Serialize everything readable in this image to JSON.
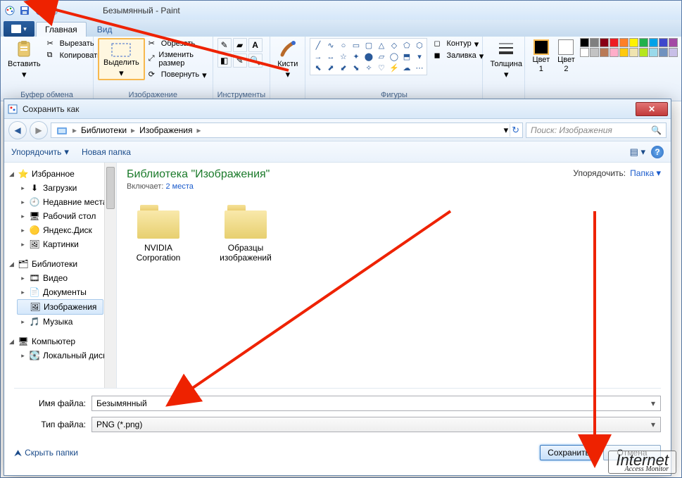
{
  "paint": {
    "title": "Безымянный - Paint",
    "tabs": {
      "home": "Главная",
      "view": "Вид"
    },
    "clipboard": {
      "paste": "Вставить",
      "cut": "Вырезать",
      "copy": "Копировать",
      "group": "Буфер обмена"
    },
    "image": {
      "select": "Выделить",
      "crop": "Обрезать",
      "resize": "Изменить размер",
      "rotate": "Повернуть",
      "group": "Изображение"
    },
    "tools": {
      "group": "Инструменты"
    },
    "brushes": {
      "label": "Кисти"
    },
    "shapes": {
      "outline": "Контур",
      "fill": "Заливка",
      "group": "Фигуры"
    },
    "size": {
      "label": "Толщина"
    },
    "colors": {
      "c1": "Цвет 1",
      "c2": "Цвет 2"
    }
  },
  "dialog": {
    "title": "Сохранить как",
    "breadcrumb": [
      "Библиотеки",
      "Изображения"
    ],
    "searchPlaceholder": "Поиск: Изображения",
    "refresh_hint": "↻",
    "toolbar": {
      "organize": "Упорядочить",
      "newfolder": "Новая папка"
    },
    "tree": {
      "favorites": "Избранное",
      "fav_items": [
        "Загрузки",
        "Недавние места",
        "Рабочий стол",
        "Яндекс.Диск",
        "Картинки"
      ],
      "libraries": "Библиотеки",
      "lib_items": [
        "Видео",
        "Документы",
        "Изображения",
        "Музыка"
      ],
      "computer": "Компьютер",
      "comp_items": [
        "Локальный диск"
      ]
    },
    "content": {
      "title": "Библиотека \"Изображения\"",
      "sub_prefix": "Включает:",
      "sub_link": "2 места",
      "sort_label": "Упорядочить:",
      "sort_value": "Папка",
      "folders": [
        "NVIDIA Corporation",
        "Образцы изображений"
      ]
    },
    "fields": {
      "name_label": "Имя файла:",
      "name_value": "Безымянный",
      "type_label": "Тип файла:",
      "type_value": "PNG (*.png)"
    },
    "footer": {
      "hide": "Скрыть папки",
      "save": "Сохранить",
      "cancel": "Отмена"
    }
  },
  "watermark": {
    "t1": "Internet",
    "t2": "Access Monitor"
  },
  "palette": [
    "#000000",
    "#7f7f7f",
    "#880015",
    "#ed1c24",
    "#ff7f27",
    "#fff200",
    "#22b14c",
    "#00a2e8",
    "#3f48cc",
    "#a349a4",
    "#ffffff",
    "#c3c3c3",
    "#b97a57",
    "#ffaec9",
    "#ffc90e",
    "#efe4b0",
    "#b5e61d",
    "#99d9ea",
    "#7092be",
    "#c8bfe7"
  ]
}
